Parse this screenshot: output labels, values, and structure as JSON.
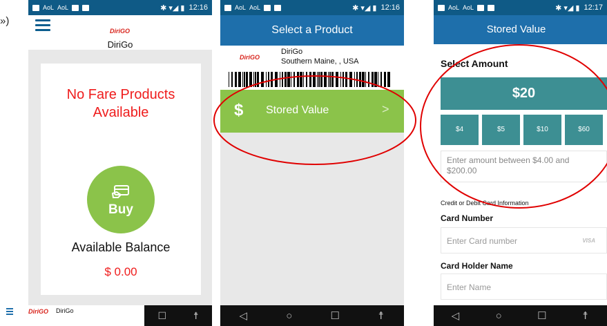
{
  "left_edge": {
    "quote_glyph": "»)"
  },
  "phone1": {
    "status": {
      "time": "12:16"
    },
    "header": {
      "logo": "DiriGO",
      "title": "DiriGo"
    },
    "card": {
      "no_fare": "No Fare Products Available",
      "buy_label": "Buy",
      "available_balance_label": "Available Balance",
      "balance_value": "$ 0.00"
    },
    "footer": {
      "logo": "DiriGO",
      "label": "DiriGo"
    }
  },
  "phone2": {
    "status": {
      "time": "12:16"
    },
    "header_title": "Select a Product",
    "agency": {
      "logo": "DiriGO",
      "name": "DiriGo",
      "location": "Southern Maine,  , USA"
    },
    "product": {
      "icon_glyph": "$",
      "label": "Stored Value",
      "chevron": ">"
    }
  },
  "phone3": {
    "status": {
      "time": "12:17"
    },
    "header_title": "Stored Value",
    "select_amount": "Select Amount",
    "main_amount": "$20",
    "amount_options": [
      "$4",
      "$5",
      "$10",
      "$60"
    ],
    "amount_placeholder": "Enter amount between $4.00 and $200.00",
    "credit_info": "Credit or Debit Card Information",
    "card_number_label": "Card Number",
    "card_number_placeholder": "Enter Card number",
    "card_brand": "VISA",
    "card_holder_label": "Card Holder Name",
    "card_holder_placeholder": "Enter Name"
  },
  "colors": {
    "status_bar": "#0f5a86",
    "header_blue": "#1e6fab",
    "accent_green": "#8bc34a",
    "teal": "#3d8f93",
    "alert_red": "#ef1c1c",
    "annotation_red": "#e00000"
  },
  "icons": [
    "hamburger-icon",
    "card-hand-icon",
    "dollar-icon",
    "chevron-right-icon",
    "visa-icon",
    "back-nav-icon",
    "home-nav-icon",
    "recents-nav-icon",
    "accessibility-icon"
  ]
}
